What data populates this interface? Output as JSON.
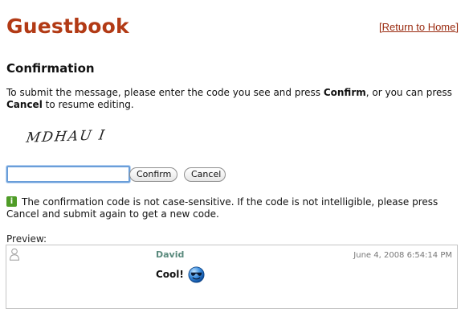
{
  "header": {
    "title": "Guestbook",
    "return_link": "Return to Home",
    "bracket_open": "[",
    "bracket_close": "]"
  },
  "confirmation": {
    "title": "Confirmation",
    "instruction_before_confirm": "To submit the message, please enter the code you see and press ",
    "confirm_word": "Confirm",
    "instruction_middle": ", or you can press ",
    "cancel_word": "Cancel",
    "instruction_after_cancel": " to resume editing.",
    "captcha_text": "MDHAU I",
    "code_value": "",
    "confirm_button": "Confirm",
    "cancel_button": "Cancel",
    "info_icon": "i",
    "info_text": "The confirmation code is not case-sensitive. If the code is not intelligible, please press Cancel and submit again to get a new code."
  },
  "preview": {
    "label": "Preview:",
    "author": "David",
    "date": "June 4, 2008 6:54:14 PM",
    "message": "Cool!",
    "avatar_icon": "user-silhouette-icon",
    "emoticon_icon": "cool-sunglasses-smiley-icon"
  },
  "colors": {
    "title": "#b23a15",
    "link": "#9a2b10",
    "author": "#5a8a7d",
    "info_icon": "#4f9c27",
    "input_focus": "#6a9ed9"
  }
}
